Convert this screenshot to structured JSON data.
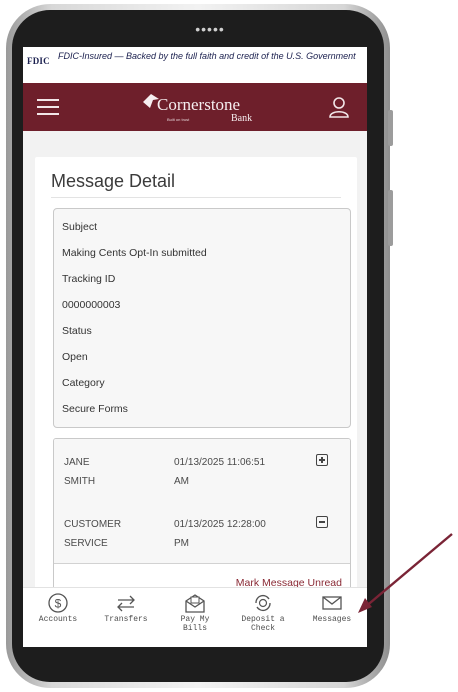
{
  "fdic": {
    "logo": "FDIC",
    "notice": "FDIC-Insured — Backed by the full faith and credit of the U.S. Government"
  },
  "header": {
    "brand_name": "Cornerstone",
    "brand_sub": "Bank",
    "brand_tagline": "Built on trust",
    "menu_icon": "hamburger-icon",
    "user_icon": "user-icon",
    "color": "#6e1f2b"
  },
  "page": {
    "title": "Message Detail"
  },
  "details": {
    "subject_label": "Subject",
    "subject_value": "Making Cents Opt-In submitted",
    "tracking_label": "Tracking ID",
    "tracking_value": "0000000003",
    "status_label": "Status",
    "status_value": "Open",
    "category_label": "Category",
    "category_value": "Secure Forms"
  },
  "thread": [
    {
      "name_line1": "JANE",
      "name_line2": "SMITH",
      "date_line1": "01/13/2025 11:06:51",
      "date_line2": "AM",
      "toggle": "expand-plus-icon"
    },
    {
      "name_line1": "CUSTOMER",
      "name_line2": "SERVICE",
      "date_line1": "01/13/2025 12:28:00",
      "date_line2": "PM",
      "toggle": "collapse-minus-icon"
    }
  ],
  "mark_unread": "Mark Message Unread",
  "nav": [
    {
      "line1": "Accounts",
      "line2": "",
      "icon": "dollar-circle-icon"
    },
    {
      "line1": "Transfers",
      "line2": "",
      "icon": "transfer-arrows-icon"
    },
    {
      "line1": "Pay My",
      "line2": "Bills",
      "icon": "envelope-bill-icon"
    },
    {
      "line1": "Deposit a",
      "line2": "Check",
      "icon": "camera-deposit-icon"
    },
    {
      "line1": "Messages",
      "line2": "",
      "icon": "mail-icon"
    }
  ],
  "annotation_color": "#7a2436"
}
